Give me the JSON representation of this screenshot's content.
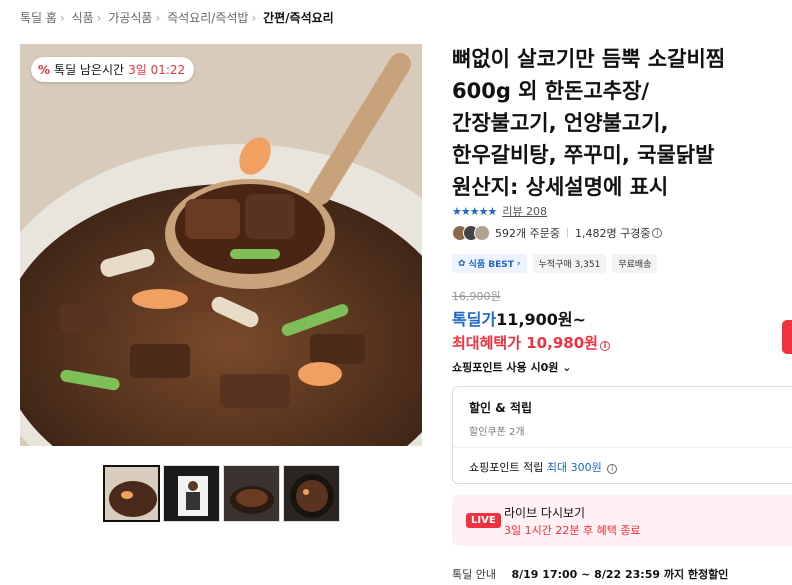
{
  "breadcrumb": [
    "톡딜 홈",
    "식품",
    "가공식품",
    "즉석요리/즉석밥",
    "간편/즉석요리"
  ],
  "timer_badge": {
    "prefix": "톡딜 남은시간",
    "value": "3일 01:22"
  },
  "product": {
    "title_lines": [
      "뼈없이 살코기만 듬뿍 소갈비찜",
      "600g 외 한돈고추장/",
      "간장불고기, 언양불고기,",
      "한우갈비탕, 쭈꾸미, 국물닭발",
      "원산지: 상세설명에 표시"
    ],
    "rating_stars": 5,
    "review_label": "리뷰 208",
    "orders": "592개 주문중",
    "subscribers": "1,482명 구경중"
  },
  "tags": [
    "식품 BEST",
    "누적구매 3,351",
    "무료배송"
  ],
  "price": {
    "original": "16,900원",
    "deal_label": "톡딜가",
    "deal_value": "11,900원~",
    "max_label": "최대혜택가",
    "max_value": "10,980원"
  },
  "point_use": "쇼핑포인트 사용 시0원",
  "benefit": {
    "header": "할인 & 적립",
    "coupon": "할인쿠폰 2개",
    "point_prefix": "쇼핑포인트 적립",
    "point_value": "최대 300원"
  },
  "live": {
    "badge": "LIVE",
    "title": "라이브 다시보기",
    "subtitle": "3일 1시간 22분 후 혜택 종료"
  },
  "deal_info": {
    "label": "톡딜 안내",
    "value": "8/19 17:00 ~ 8/22 23:59 까지 한정할인"
  },
  "colors": {
    "accent_red": "#f0313e",
    "accent_blue": "#1e67c9"
  }
}
